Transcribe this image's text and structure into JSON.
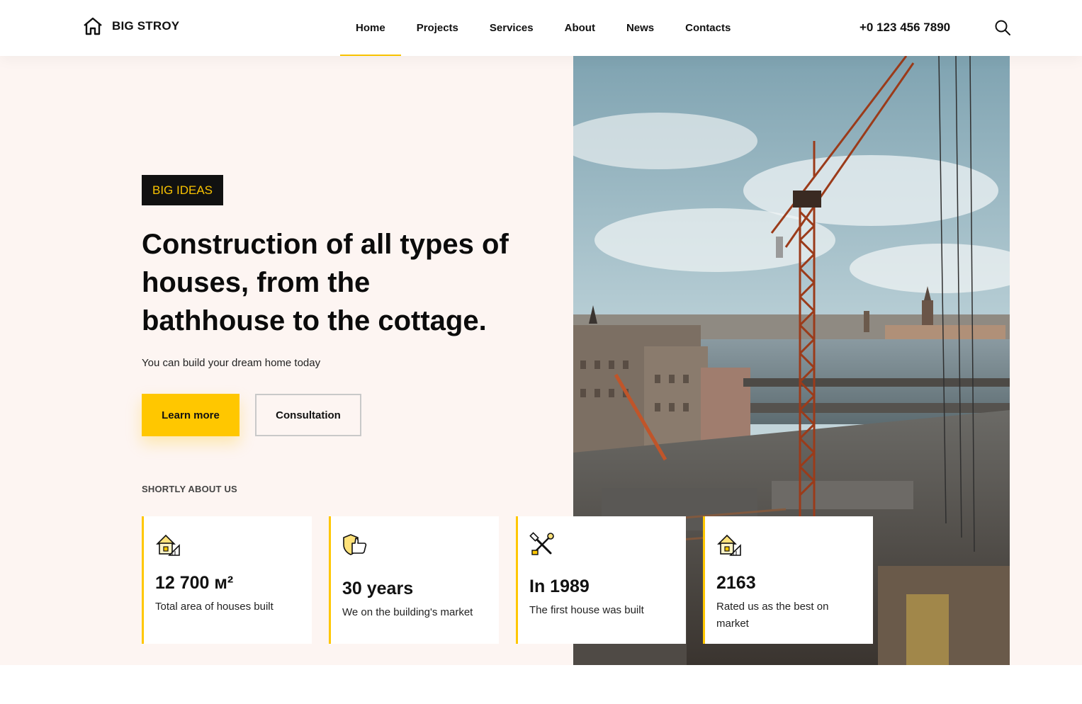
{
  "brand": {
    "name": "BIG STROY",
    "accent": "#ffc700",
    "icon": "house-icon"
  },
  "nav": {
    "items": [
      {
        "label": "Home",
        "active": true
      },
      {
        "label": "Projects",
        "active": false
      },
      {
        "label": "Services",
        "active": false
      },
      {
        "label": "About",
        "active": false
      },
      {
        "label": "News",
        "active": false
      },
      {
        "label": "Contacts",
        "active": false
      }
    ]
  },
  "header": {
    "phone": "+0 123 456 7890",
    "search_icon": "search-icon"
  },
  "hero": {
    "tag": "BIG IDEAS",
    "headline_lines": [
      "Construction of all types of",
      "houses, from the",
      "bathhouse to the cottage."
    ],
    "subline": "You can build your dream home today",
    "primary_button": "Learn more",
    "secondary_button": "Consultation",
    "photo": "construction-crane-cityscape"
  },
  "about": {
    "label": "SHORTLY ABOUT US",
    "stats": [
      {
        "value": "12 700 м²",
        "caption": "Total area of houses built",
        "icon": "house-plan-icon"
      },
      {
        "value": "30 years",
        "caption": "We on the building's market",
        "icon": "shield-thumb-icon"
      },
      {
        "value": "In 1989",
        "caption": "The first house was built",
        "icon": "tools-icon"
      },
      {
        "value": "2163",
        "caption": "Rated us as the best on market",
        "icon": "house-plan-icon"
      }
    ]
  }
}
